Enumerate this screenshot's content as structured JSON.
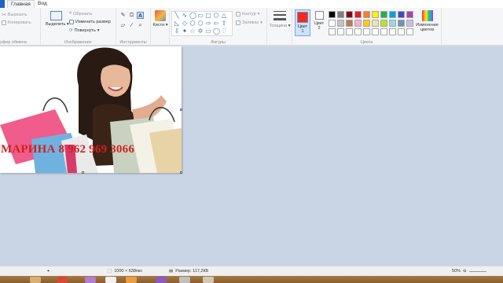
{
  "tabs": [
    {
      "label": "Главная",
      "active": true
    },
    {
      "label": "Вид",
      "active": false
    }
  ],
  "clipboard": {
    "cut_label": "Вырезать",
    "copy_label": "Копировать",
    "group_label": "уфер обмена"
  },
  "image_group": {
    "select_label": "Выделить",
    "crop_label": "Обрезать",
    "resize_label": "Изменить размер",
    "rotate_label": "Повернуть",
    "group_label": "Изображение"
  },
  "tools": {
    "group_label": "Инструменты",
    "brushes_label": "Кисти",
    "items": [
      "pencil-icon",
      "fill-icon",
      "text-icon",
      "eraser-icon",
      "color-picker-icon",
      "magnifier-icon"
    ]
  },
  "shapes": {
    "group_label": "Фигуры",
    "outline_label": "Контур",
    "fill_label": "Заливка",
    "items": [
      "line",
      "curve",
      "oval",
      "rectangle",
      "rounded-rectangle",
      "polygon",
      "triangle",
      "right-triangle",
      "diamond",
      "pentagon",
      "hexagon",
      "arrow-right",
      "arrow-left",
      "arrow-up",
      "arrow-down",
      "star-4",
      "star-5",
      "star-6",
      "callout-rect",
      "callout-oval",
      "callout-cloud",
      "heart",
      "lightning"
    ]
  },
  "size": {
    "label": "Толщина"
  },
  "colors": {
    "group_label": "Цвета",
    "color1_label": "Цвет\n1",
    "color2_label": "Цвет\n2",
    "color1": "#ee2c24",
    "color2": "#ffffff",
    "edit_label": "Изменение\nцветов",
    "palette_row1": [
      "#000000",
      "#7f7f7f",
      "#880015",
      "#ed1c24",
      "#ff7f27",
      "#fff200",
      "#22b14c",
      "#00a2e8",
      "#3f48cc",
      "#a349a4"
    ],
    "palette_row2": [
      "#ffffff",
      "#c3c3c3",
      "#b97a57",
      "#ffaec9",
      "#ffc90e",
      "#efe4b0",
      "#b5e61d",
      "#99d9ea",
      "#7092be",
      "#c8bfe7"
    ]
  },
  "canvas": {
    "text": "МАРИНА 8 962 969 3066"
  },
  "status": {
    "dimensions": "1000 × 638пкс",
    "file_size": "Размер: 117,2КБ",
    "zoom": "50%"
  }
}
